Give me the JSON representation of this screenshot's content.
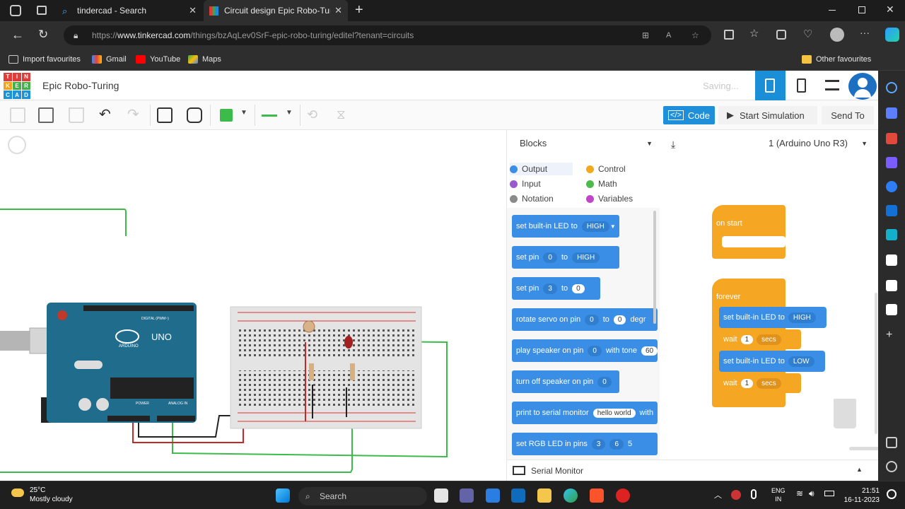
{
  "browser": {
    "tabs": [
      {
        "title": "tindercad - Search"
      },
      {
        "title": "Circuit design Epic Robo-Turing"
      }
    ],
    "url_prefix": "https://",
    "url_host": "www.tinkercad.com",
    "url_path": "/things/bzAqLev0SrF-epic-robo-turing/editel?tenant=circuits",
    "favourites": [
      "Import favourites",
      "Gmail",
      "YouTube",
      "Maps"
    ],
    "other_favourites": "Other favourites"
  },
  "app": {
    "logo_letters": [
      "TIN",
      "KER",
      "CAD"
    ],
    "logo_cells": [
      "T",
      "I",
      "N",
      "K",
      "E",
      "R",
      "C",
      "A",
      "D"
    ],
    "project_title": "Epic Robo-Turing",
    "saving": "Saving...",
    "code_button": "Code",
    "start_sim": "Start Simulation",
    "send_to": "Send To"
  },
  "code_panel": {
    "mode": "Blocks",
    "board": "1 (Arduino Uno R3)",
    "categories": [
      "Output",
      "Control",
      "Input",
      "Math",
      "Notation",
      "Variables"
    ],
    "category_colors": [
      "#3a8ee6",
      "#f2a91b",
      "#9b59d0",
      "#4cbb4c",
      "#8a8a8a",
      "#c045c8"
    ],
    "palette": [
      {
        "text": "set built-in LED to",
        "d1": "HIGH"
      },
      {
        "text": "set pin",
        "d1": "0",
        "t2": "to",
        "d2": "HIGH"
      },
      {
        "text": "set pin",
        "d1": "3",
        "t2": "to",
        "n": "0"
      },
      {
        "text": "rotate servo on pin",
        "d1": "0",
        "t2": "to",
        "n": "0",
        "t3": "degr"
      },
      {
        "text": "play speaker on pin",
        "d1": "0",
        "t2": "with tone",
        "n": "60"
      },
      {
        "text": "turn off speaker on pin",
        "d1": "0"
      },
      {
        "text": "print to serial monitor",
        "n": "hello world",
        "t2": "with"
      },
      {
        "text": "set RGB LED in pins",
        "d1": "3",
        "d2": "6",
        "t3": "5"
      }
    ],
    "workspace": {
      "on_start": "on start",
      "forever": "forever",
      "led1_text": "set built-in LED to",
      "led1_val": "HIGH",
      "wait1_text": "wait",
      "wait1_num": "1",
      "wait1_unit": "secs",
      "led2_text": "set built-in LED to",
      "led2_val": "LOW",
      "wait2_text": "wait",
      "wait2_num": "1",
      "wait2_unit": "secs"
    },
    "serial_monitor": "Serial Monitor"
  },
  "board_labels": {
    "digital": "DIGITAL (PWM~)",
    "arduino": "ARDUINO",
    "uno": "UNO",
    "power": "POWER",
    "analog": "ANALOG IN"
  },
  "taskbar": {
    "temp": "25°C",
    "weather": "Mostly cloudy",
    "search": "Search",
    "lang1": "ENG",
    "lang2": "IN",
    "time": "21:51",
    "date": "16-11-2023"
  }
}
